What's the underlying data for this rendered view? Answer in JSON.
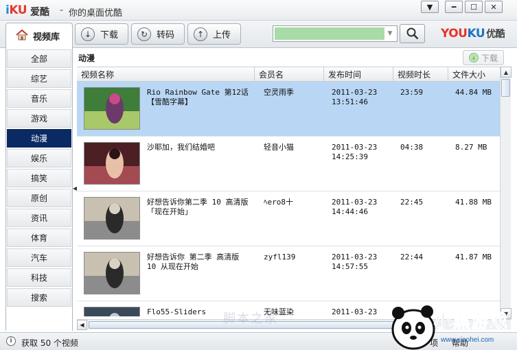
{
  "titlebar": {
    "logo_i": "i",
    "logo_ku": "KU",
    "app_name": "爱酷",
    "separator": "-",
    "slogan": "你的桌面优酷",
    "buttons": [
      "chevron-down-icon",
      "minimize-icon",
      "maximize-icon",
      "close-icon"
    ]
  },
  "toolbar": {
    "library_tab": "视频库",
    "download_label": "下载",
    "convert_label": "转码",
    "upload_label": "上传",
    "search_value": "",
    "brand_y": "YOU",
    "brand_k": "KU",
    "brand_cn": "优酷"
  },
  "sidebar": {
    "categories": [
      "全部",
      "综艺",
      "音乐",
      "游戏",
      "动漫",
      "娱乐",
      "搞笑",
      "原创",
      "资讯",
      "体育",
      "汽车",
      "科技",
      "搜索"
    ],
    "active_index": 4
  },
  "main": {
    "section_title": "动漫",
    "download_button": "下载",
    "columns": [
      "视频名称",
      "会员名",
      "发布时间",
      "视频时长",
      "文件大小"
    ],
    "rows": [
      {
        "title": "Rio Rainbow Gate 第12话【雪酷字幕】",
        "user": "空灵雨季",
        "date": "2011-03-23",
        "time": "13:51:46",
        "duration": "23:59",
        "size": "44.84 MB",
        "selected": true
      },
      {
        "title": "沙耶加，我们结婚吧",
        "user": "轻音小猫",
        "date": "2011-03-23",
        "time": "14:25:39",
        "duration": "04:38",
        "size": "8.27 MB",
        "selected": false
      },
      {
        "title": "好想告诉你第二季 10 高清版「现在开始」",
        "user": "ﾍero8十",
        "date": "2011-03-23",
        "time": "14:44:46",
        "duration": "22:45",
        "size": "41.88 MB",
        "selected": false
      },
      {
        "title": "好想告诉你 第二季 高清版 10 从现在开始",
        "user": "zyfl139",
        "date": "2011-03-23",
        "time": "14:57:55",
        "duration": "22:44",
        "size": "41.87 MB",
        "selected": false
      },
      {
        "title": "Flo55-Sliders",
        "user": "无味蓝染",
        "date": "2011-03-23",
        "time": "",
        "duration": "",
        "size": "",
        "selected": false
      }
    ]
  },
  "status": {
    "text": "获取 50 个视频",
    "link1": "项",
    "link2": "帮助"
  },
  "watermark": {
    "text": "脚本之家",
    "mascot_label": "小黑游戏",
    "url": "www.xiaohei.com"
  },
  "colors": {
    "selected_row": "#b9d7f5",
    "active_category": "#0a2a63",
    "search_fill": "#a8dca6",
    "youku_red": "#e5352c",
    "youku_blue": "#1f73c4"
  }
}
